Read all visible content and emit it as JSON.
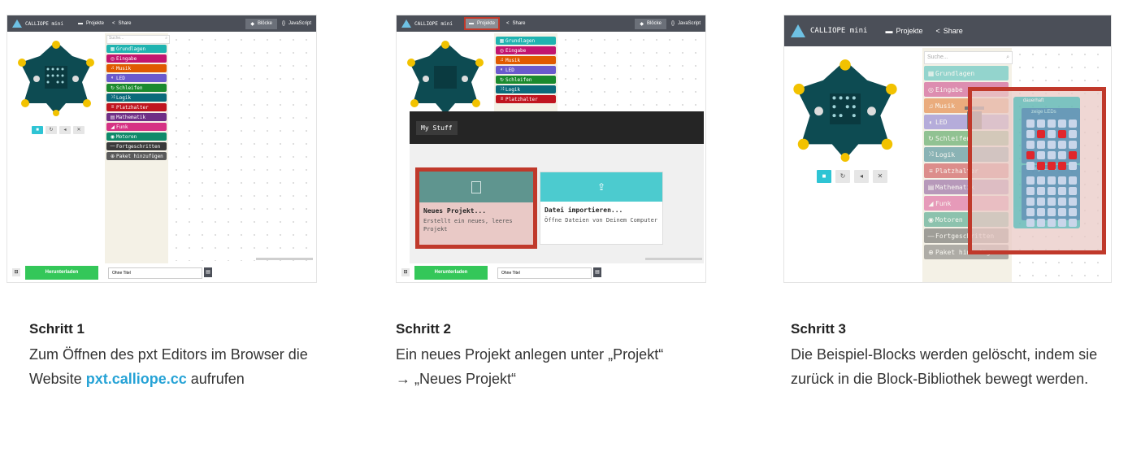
{
  "brand": "CALLIOPE mini",
  "nav": {
    "projects": "Projekte",
    "share": "Share",
    "blocks": "Blöcke",
    "javascript": "JavaScript"
  },
  "search_placeholder": "Suche...",
  "categories": [
    {
      "label": "Grundlagen",
      "color": "#1fb3b0",
      "icon": "grid-icon"
    },
    {
      "label": "Eingabe",
      "color": "#c2156f",
      "icon": "target-icon"
    },
    {
      "label": "Musik",
      "color": "#e05a00",
      "icon": "headphones-icon"
    },
    {
      "label": "LED",
      "color": "#6a5acd",
      "icon": "toggle-icon"
    },
    {
      "label": "Schleifen",
      "color": "#1b8a2e",
      "icon": "loop-icon"
    },
    {
      "label": "Logik",
      "color": "#0b6a7a",
      "icon": "shuffle-icon"
    },
    {
      "label": "Platzhalter",
      "color": "#c0151f",
      "icon": "list-icon"
    },
    {
      "label": "Mathematik",
      "color": "#6f2f86",
      "icon": "calculator-icon"
    },
    {
      "label": "Funk",
      "color": "#d63384",
      "icon": "signal-icon"
    },
    {
      "label": "Motoren",
      "color": "#0f8a6a",
      "icon": "car-icon"
    },
    {
      "label": "Fortgeschritten",
      "color": "#3a3a3a",
      "icon": "dash-icon"
    },
    {
      "label": "Paket hinzufügen",
      "color": "#5a5a5a",
      "icon": "add-circle-icon"
    }
  ],
  "download_label": "Herunterladen",
  "project_name": "Ohne Titel",
  "mystuff_label": "My Stuff",
  "new_project": {
    "title": "Neues Projekt...",
    "desc": "Erstellt ein neues, leeres Projekt"
  },
  "import": {
    "title": "Datei importieren...",
    "desc": "Öffne Dateien von Deinem Computer"
  },
  "step3_blocks": {
    "forever": "dauerhaft",
    "show_leds_1": "zeige LEDs",
    "show_leds_2": "zeige LEDs"
  },
  "steps": [
    {
      "title": "Schritt 1",
      "text_before": "Zum Öffnen des pxt Editors im Browser die Website ",
      "link": "pxt.calliope.cc",
      "text_after": " aufrufen"
    },
    {
      "title": "Schritt 2",
      "text_before": "Ein neues Projekt anlegen unter „Projekt“ → „Neues Projekt“"
    },
    {
      "title": "Schritt 3",
      "text_before": "Die Beispiel-Blocks werden gelöscht, indem sie zurück in die Block-Bibliothek bewegt werden."
    }
  ],
  "colors": {
    "accent": "#2ec4d4",
    "highlight": "#c0392b",
    "green": "#34c759",
    "topbar": "#4b4f58"
  }
}
